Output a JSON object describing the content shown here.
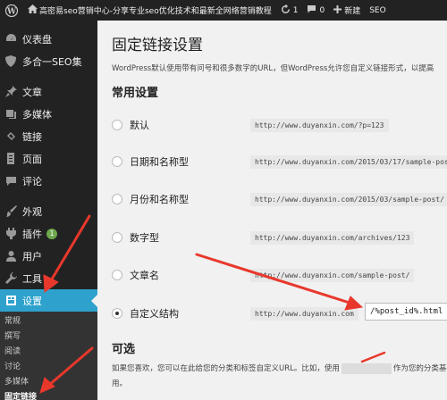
{
  "admin_bar": {
    "site_name": "高密易seo营销中心-分享专业seo优化技术和最新全网络营销教程",
    "updates_count": "1",
    "comments_count": "0",
    "new_label": "新建",
    "seo_label": "SEO"
  },
  "sidebar": {
    "items": [
      {
        "label": "仪表盘",
        "icon": "dashboard-icon"
      },
      {
        "label": "多合一SEO集",
        "icon": "shield-icon"
      },
      {
        "label": "文章",
        "icon": "pin-icon"
      },
      {
        "label": "多媒体",
        "icon": "media-icon"
      },
      {
        "label": "链接",
        "icon": "link-icon"
      },
      {
        "label": "页面",
        "icon": "page-icon"
      },
      {
        "label": "评论",
        "icon": "comment-icon"
      },
      {
        "label": "外观",
        "icon": "brush-icon"
      },
      {
        "label": "插件",
        "icon": "plugin-icon",
        "badge": "1"
      },
      {
        "label": "用户",
        "icon": "user-icon"
      },
      {
        "label": "工具",
        "icon": "wrench-icon"
      },
      {
        "label": "设置",
        "icon": "settings-icon"
      }
    ],
    "submenu": [
      "常规",
      "撰写",
      "阅读",
      "讨论",
      "多媒体",
      "固定链接"
    ]
  },
  "main": {
    "title": "固定链接设置",
    "intro": "WordPress默认使用带有问号和很多数字的URL，但WordPress允许您自定义链接形式，以提高",
    "common_settings": "常用设置",
    "options": [
      {
        "label": "默认",
        "example": "http://www.duyanxin.com/?p=123",
        "checked": false
      },
      {
        "label": "日期和名称型",
        "example": "http://www.duyanxin.com/2015/03/17/sample-pos",
        "checked": false
      },
      {
        "label": "月份和名称型",
        "example": "http://www.duyanxin.com/2015/03/sample-post/",
        "checked": false
      },
      {
        "label": "数字型",
        "example": "http://www.duyanxin.com/archives/123",
        "checked": false
      },
      {
        "label": "文章名",
        "example": "http://www.duyanxin.com/sample-post/",
        "checked": false
      },
      {
        "label": "自定义结构",
        "example": "http://www.duyanxin.com",
        "checked": true,
        "value": "/%post_id%.html"
      }
    ],
    "optional_title": "可选",
    "optional_desc_1": "如果您喜欢，您可以在此给您的分类和标签自定义URL。比如，使用",
    "optional_desc_2": "作为您的分类基础",
    "optional_desc_3": "用。"
  },
  "colors": {
    "admin_bg": "#222222",
    "accent": "#2ea2cc",
    "arrow": "#e8382c"
  }
}
